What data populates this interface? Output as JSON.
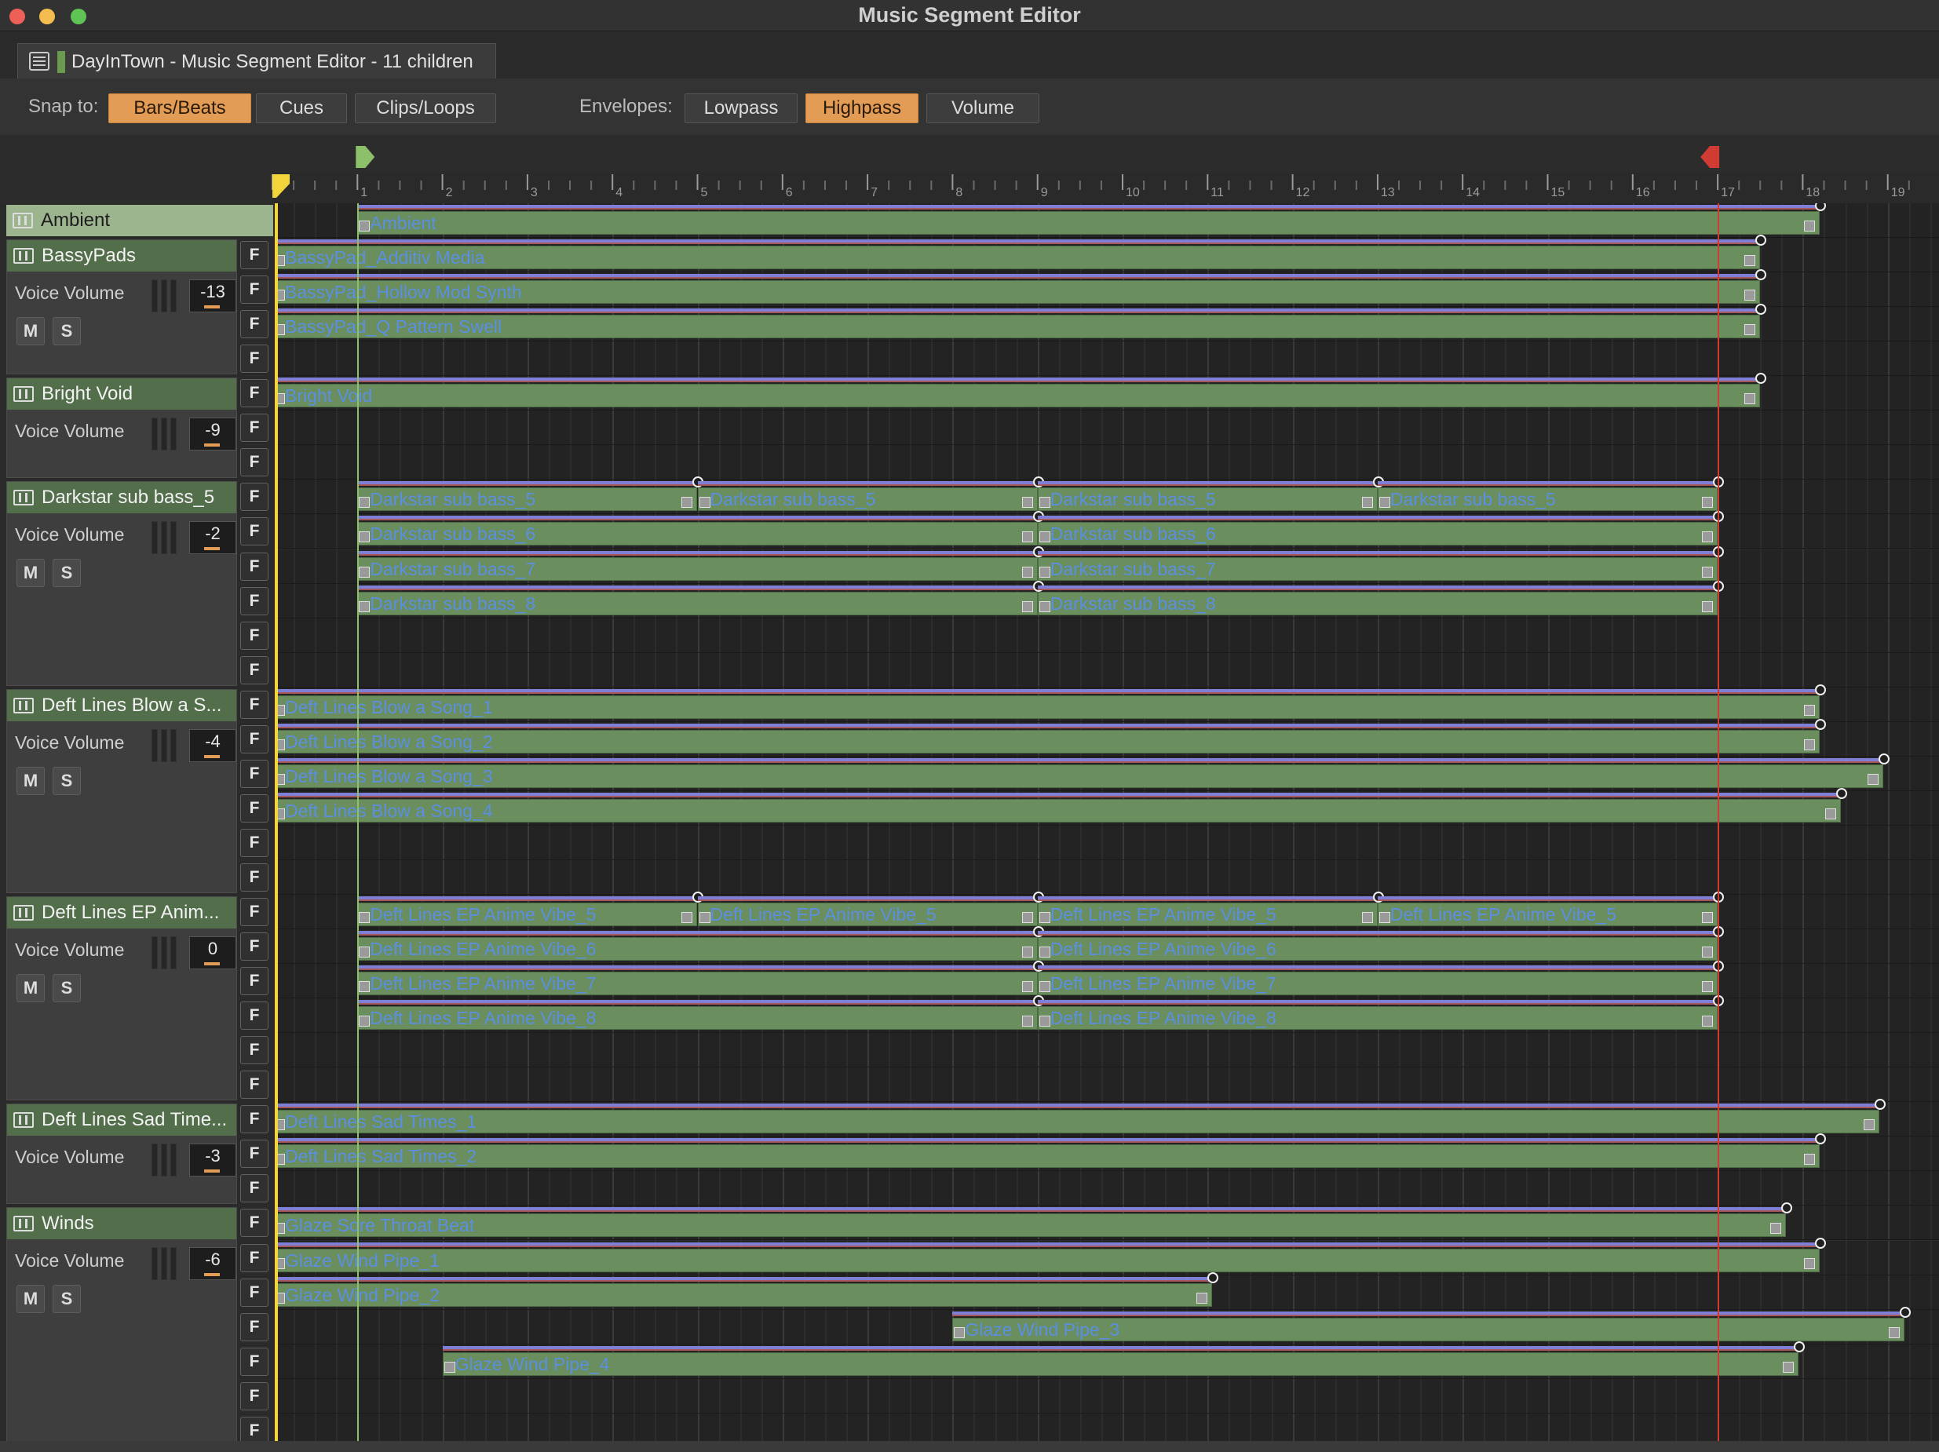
{
  "window": {
    "title": "Music Segment Editor",
    "controls": [
      "close-icon",
      "minimize-icon",
      "zoom-icon"
    ]
  },
  "tab": {
    "label": "DayInTown - Music Segment Editor - 11 children",
    "icon": "segment-editor-icon"
  },
  "toolbar": {
    "snap_label": "Snap to:",
    "snap_options": [
      {
        "label": "Bars/Beats",
        "active": true
      },
      {
        "label": "Cues",
        "active": false
      },
      {
        "label": "Clips/Loops",
        "active": false
      }
    ],
    "env_label": "Envelopes:",
    "env_options": [
      {
        "label": "Lowpass",
        "active": false
      },
      {
        "label": "Highpass",
        "active": true
      },
      {
        "label": "Volume",
        "active": false
      }
    ]
  },
  "ruler": {
    "bars": [
      "1",
      "2",
      "3",
      "4",
      "5",
      "6",
      "7",
      "8",
      "9",
      "10",
      "11",
      "12",
      "13",
      "14",
      "15",
      "16",
      "17",
      "18",
      "19"
    ],
    "entry_cue": "1",
    "exit_cue": "17"
  },
  "colors": {
    "clip": "#6a8e5e",
    "clip_name": "#5b8fe2",
    "active_button": "#e29c55",
    "exit_cue": "#d03b32",
    "entry_cue": "#8cc06b",
    "playhead": "#f2d53a"
  },
  "voice_volume_label": "Voice Volume",
  "mute_label": "M",
  "solo_label": "S",
  "f_label": "F",
  "groups": [
    {
      "name": "Ambient",
      "first_row": 0,
      "rows": 1,
      "header_only": true
    },
    {
      "name": "BassyPads",
      "first_row": 1,
      "rows": 4,
      "volume": "-13",
      "ms": true
    },
    {
      "name": "Bright Void",
      "first_row": 5,
      "rows": 3,
      "volume": "-9",
      "ms": false
    },
    {
      "name": "Darkstar sub bass_5",
      "first_row": 8,
      "rows": 6,
      "volume": "-2",
      "ms": true
    },
    {
      "name": "Deft Lines Blow a S...",
      "first_row": 14,
      "rows": 6,
      "volume": "-4",
      "ms": true
    },
    {
      "name": "Deft Lines EP Anim...",
      "first_row": 20,
      "rows": 6,
      "volume": "0",
      "ms": true
    },
    {
      "name": "Deft Lines Sad Time...",
      "first_row": 26,
      "rows": 3,
      "volume": "-3",
      "ms": false
    },
    {
      "name": "Winds",
      "first_row": 29,
      "rows": 7,
      "volume": "-6",
      "ms": true
    }
  ],
  "clips": [
    {
      "row": 0,
      "start": 1,
      "end": 18.2,
      "name": "Ambient"
    },
    {
      "row": 1,
      "start": 0,
      "end": 17.5,
      "name": "BassyPad_Additiv Media"
    },
    {
      "row": 2,
      "start": 0,
      "end": 17.5,
      "name": "BassyPad_Hollow Mod Synth"
    },
    {
      "row": 3,
      "start": 0,
      "end": 17.5,
      "name": "BassyPad_Q Pattern Swell"
    },
    {
      "row": 5,
      "start": 0,
      "end": 17.5,
      "name": "Bright Void"
    },
    {
      "row": 8,
      "start": 1,
      "end": 5,
      "name": "Darkstar sub bass_5"
    },
    {
      "row": 8,
      "start": 5,
      "end": 9,
      "name": "Darkstar sub bass_5"
    },
    {
      "row": 8,
      "start": 9,
      "end": 13,
      "name": "Darkstar sub bass_5"
    },
    {
      "row": 8,
      "start": 13,
      "end": 17,
      "name": "Darkstar sub bass_5"
    },
    {
      "row": 9,
      "start": 1,
      "end": 9,
      "name": "Darkstar sub bass_6"
    },
    {
      "row": 9,
      "start": 9,
      "end": 17,
      "name": "Darkstar sub bass_6"
    },
    {
      "row": 10,
      "start": 1,
      "end": 9,
      "name": "Darkstar sub bass_7"
    },
    {
      "row": 10,
      "start": 9,
      "end": 17,
      "name": "Darkstar sub bass_7"
    },
    {
      "row": 11,
      "start": 1,
      "end": 9,
      "name": "Darkstar sub bass_8"
    },
    {
      "row": 11,
      "start": 9,
      "end": 17,
      "name": "Darkstar sub bass_8"
    },
    {
      "row": 14,
      "start": 0,
      "end": 18.2,
      "name": "Deft Lines Blow a Song_1"
    },
    {
      "row": 15,
      "start": 0,
      "end": 18.2,
      "name": "Deft Lines Blow a Song_2"
    },
    {
      "row": 16,
      "start": 0,
      "end": 18.95,
      "name": "Deft Lines Blow a Song_3"
    },
    {
      "row": 17,
      "start": 0,
      "end": 18.45,
      "name": "Deft Lines Blow a Song_4"
    },
    {
      "row": 20,
      "start": 1,
      "end": 5,
      "name": "Deft Lines EP Anime Vibe_5"
    },
    {
      "row": 20,
      "start": 5,
      "end": 9,
      "name": "Deft Lines EP Anime Vibe_5"
    },
    {
      "row": 20,
      "start": 9,
      "end": 13,
      "name": "Deft Lines EP Anime Vibe_5"
    },
    {
      "row": 20,
      "start": 13,
      "end": 17,
      "name": "Deft Lines EP Anime Vibe_5"
    },
    {
      "row": 21,
      "start": 1,
      "end": 9,
      "name": "Deft Lines EP Anime Vibe_6"
    },
    {
      "row": 21,
      "start": 9,
      "end": 17,
      "name": "Deft Lines EP Anime Vibe_6"
    },
    {
      "row": 22,
      "start": 1,
      "end": 9,
      "name": "Deft Lines EP Anime Vibe_7"
    },
    {
      "row": 22,
      "start": 9,
      "end": 17,
      "name": "Deft Lines EP Anime Vibe_7"
    },
    {
      "row": 23,
      "start": 1,
      "end": 9,
      "name": "Deft Lines EP Anime Vibe_8"
    },
    {
      "row": 23,
      "start": 9,
      "end": 17,
      "name": "Deft Lines EP Anime Vibe_8"
    },
    {
      "row": 26,
      "start": 0,
      "end": 18.9,
      "name": "Deft Lines Sad Times_1"
    },
    {
      "row": 27,
      "start": 0,
      "end": 18.2,
      "name": "Deft Lines Sad Times_2"
    },
    {
      "row": 29,
      "start": 0,
      "end": 17.8,
      "name": "Glaze Sore Throat Beat"
    },
    {
      "row": 30,
      "start": 0,
      "end": 18.2,
      "name": "Glaze Wind Pipe_1"
    },
    {
      "row": 31,
      "start": 0,
      "end": 11.05,
      "name": "Glaze Wind Pipe_2"
    },
    {
      "row": 32,
      "start": 8,
      "end": 19.2,
      "name": "Glaze Wind Pipe_3"
    },
    {
      "row": 33,
      "start": 2,
      "end": 17.95,
      "name": "Glaze Wind Pipe_4"
    }
  ]
}
